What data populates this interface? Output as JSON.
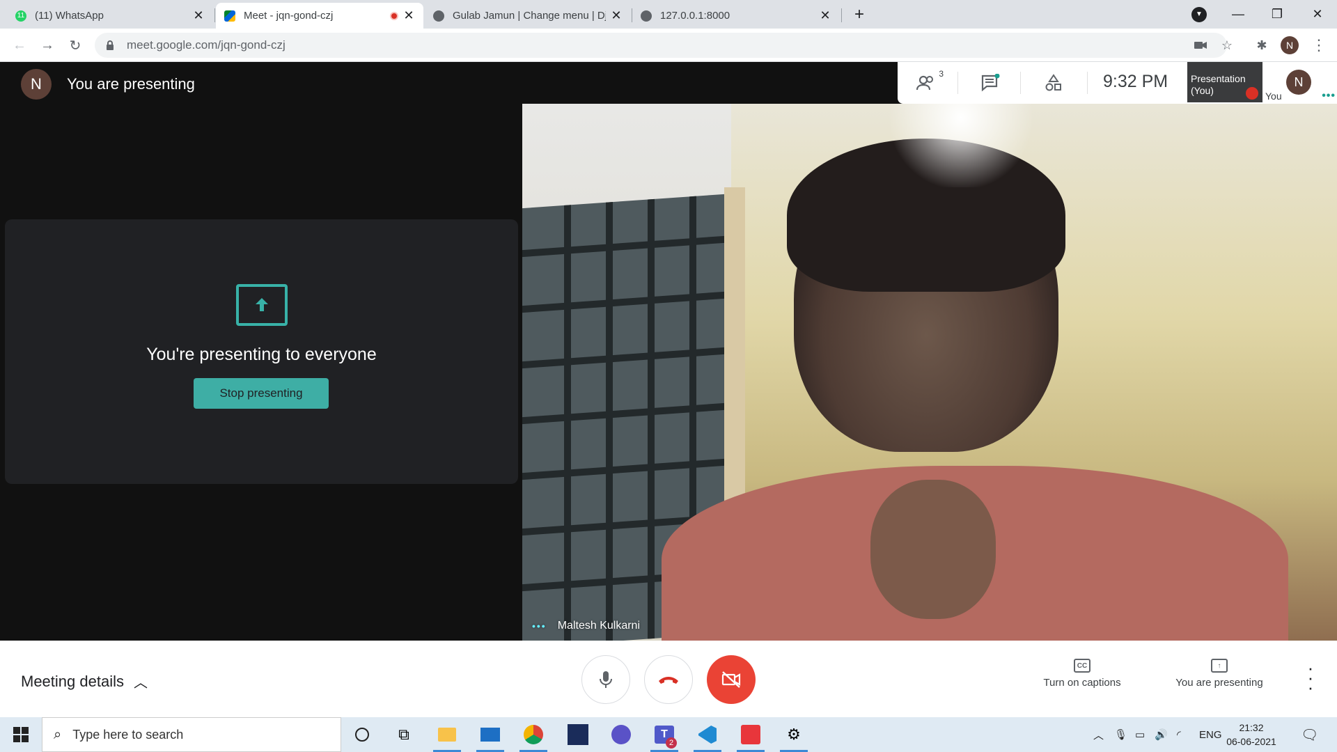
{
  "browser": {
    "tabs": [
      {
        "label": "(11) WhatsApp",
        "favicon": "whatsapp-icon",
        "badge": "11"
      },
      {
        "label": "Meet - jqn-gond-czj",
        "favicon": "meet-icon",
        "recording": true
      },
      {
        "label": "Gulab Jamun | Change menu | Dj",
        "favicon": "globe-icon"
      },
      {
        "label": "127.0.0.1:8000",
        "favicon": "globe-icon"
      }
    ],
    "url": "meet.google.com/jqn-gond-czj",
    "profile_initial": "N"
  },
  "meet": {
    "presenter_initial": "N",
    "presenting_header": "You are presenting",
    "people_count": "3",
    "clock": "9:32 PM",
    "presentation_tile_label": "Presentation\n(You)",
    "you_tile_label": "You",
    "you_initial": "N",
    "present_message": "You're presenting to everyone",
    "stop_button": "Stop presenting",
    "video_name": "Maltesh Kulkarni",
    "meeting_details": "Meeting details",
    "captions_label": "Turn on captions",
    "presenting_label": "You are presenting",
    "cc_text": "CC"
  },
  "taskbar": {
    "search_placeholder": "Type here to search",
    "teams_badge": "2",
    "language": "ENG",
    "time": "21:32",
    "date": "06-06-2021"
  },
  "colors": {
    "accent_teal": "#3eaea5",
    "end_call_red": "#ea4335",
    "meet_dark_bg": "#111111"
  }
}
